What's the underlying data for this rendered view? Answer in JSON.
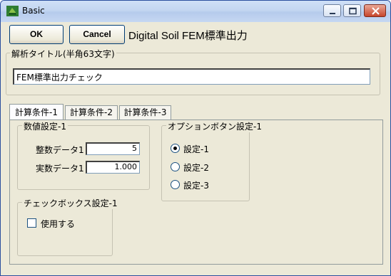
{
  "window": {
    "title": "Basic",
    "icon": "app-leaf-icon"
  },
  "toolbar": {
    "ok_label": "OK",
    "cancel_label": "Cancel",
    "heading": "Digital Soil FEM標準出力"
  },
  "analysis_title": {
    "legend": "解析タイトル(半角63文字)",
    "value": "FEM標準出力チェック"
  },
  "tabs": [
    {
      "label": "計算条件-1",
      "active": true
    },
    {
      "label": "計算条件-2",
      "active": false
    },
    {
      "label": "計算条件-3",
      "active": false
    }
  ],
  "numeric_settings": {
    "legend": "数値設定-1",
    "integer_label": "整数データ1",
    "integer_value": "5",
    "real_label": "実数データ1",
    "real_value": "1.000"
  },
  "option_buttons": {
    "legend": "オプションボタン設定-1",
    "options": [
      {
        "label": "設定-1",
        "selected": true
      },
      {
        "label": "設定-2",
        "selected": false
      },
      {
        "label": "設定-3",
        "selected": false
      }
    ]
  },
  "checkbox_settings": {
    "legend": "チェックボックス設定-1",
    "checkbox_label": "使用する",
    "checked": false
  }
}
